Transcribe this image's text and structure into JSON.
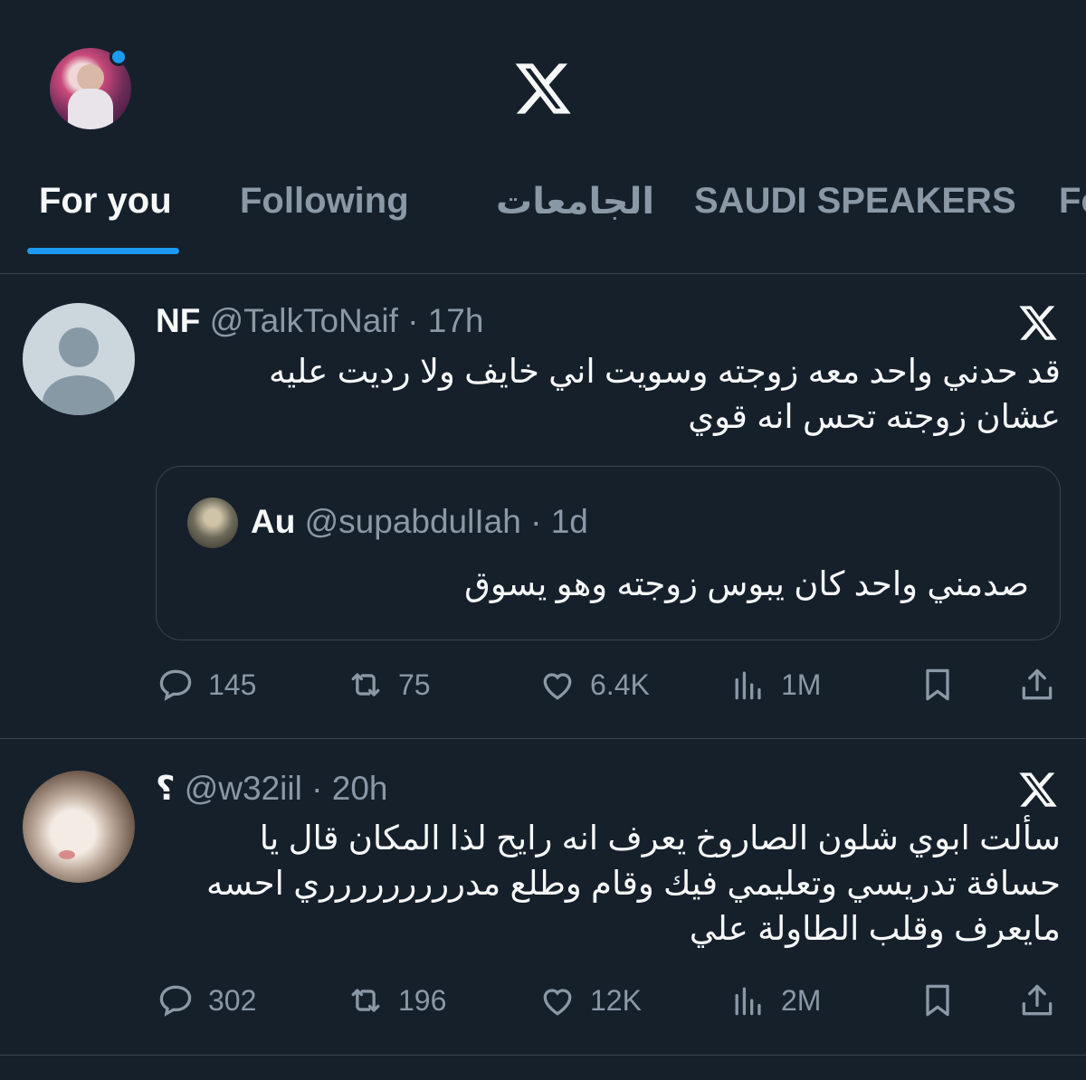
{
  "header": {
    "logo": "x-logo-icon",
    "colors": {
      "background": "#15202b",
      "accent": "#1d9bf0",
      "secondary_text": "#8b98a5",
      "border": "#38444d"
    }
  },
  "tabs": [
    {
      "label": "For you",
      "active": true
    },
    {
      "label": "Following",
      "active": false
    },
    {
      "label": "الجامعات",
      "active": false
    },
    {
      "label": "SAUDI SPEAKERS",
      "active": false
    },
    {
      "label": "Fo",
      "active": false
    }
  ],
  "tweets": [
    {
      "name": "NF",
      "handle": "@TalkToNaif",
      "time": "17h",
      "text_lines": [
        "قد حدني واحد معه زوجته وسويت اني خايف ولا رديت عليه",
        "عشان زوجته تحس انه قوي"
      ],
      "quote": {
        "name": "Au",
        "handle": "@supabdulIah",
        "time": "1d",
        "text": "صدمني واحد كان يبوس زوجته وهو يسوق"
      },
      "stats": {
        "replies": "145",
        "retweets": "75",
        "likes": "6.4K",
        "views": "1M"
      }
    },
    {
      "name": "؟",
      "handle": "@w32iil",
      "time": "20h",
      "text_lines": [
        "سألت ابوي شلون الصاروخ يعرف انه رايح لذا المكان قال يا",
        "حسافة تدريسي وتعليمي فيك وقام وطلع مدررررررررري احسه",
        "مايعرف وقلب الطاولة علي"
      ],
      "stats": {
        "replies": "302",
        "retweets": "196",
        "likes": "12K",
        "views": "2M"
      }
    }
  ]
}
